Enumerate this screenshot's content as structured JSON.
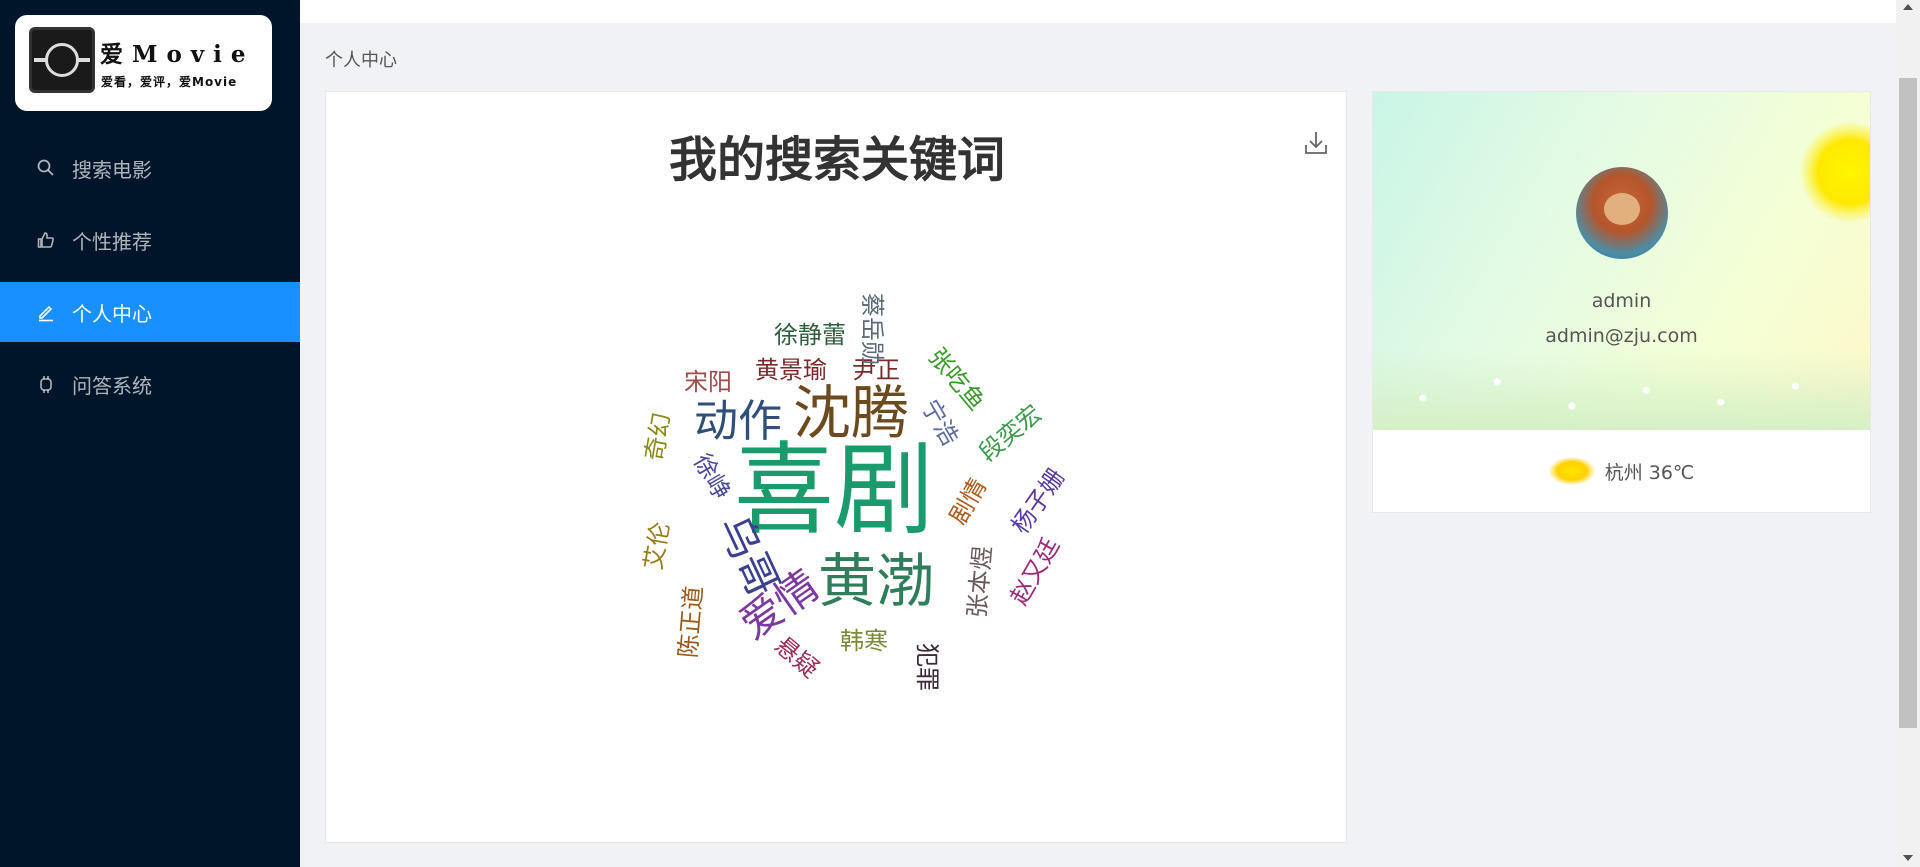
{
  "sidebar": {
    "logo": {
      "title": "爱Movie",
      "subtitle": "爱看，爱评，爱Movie"
    },
    "items": [
      {
        "label": "搜索电影",
        "icon": "search-icon"
      },
      {
        "label": "个性推荐",
        "icon": "thumbs-up-icon"
      },
      {
        "label": "个人中心",
        "icon": "edit-icon",
        "active": true
      },
      {
        "label": "问答系统",
        "icon": "robot-icon"
      }
    ]
  },
  "breadcrumb": "个人中心",
  "wordcloud": {
    "title": "我的搜索关键词",
    "words": [
      {
        "text": "喜剧",
        "color": "#1a9b6c"
      },
      {
        "text": "沈腾",
        "color": "#6b4a1e"
      },
      {
        "text": "黄渤",
        "color": "#2e7d5b"
      },
      {
        "text": "动作",
        "color": "#2f4f7a"
      },
      {
        "text": "乌哥",
        "color": "#3a3f8f"
      },
      {
        "text": "爱情",
        "color": "#7a3aa0"
      },
      {
        "text": "徐静蕾",
        "color": "#2e5e3e"
      },
      {
        "text": "黄景瑜",
        "color": "#7a2a2a"
      },
      {
        "text": "尹正",
        "color": "#7a2a2a"
      },
      {
        "text": "宋阳",
        "color": "#a04a4a"
      },
      {
        "text": "蔡岳勋",
        "color": "#5a6a7a"
      },
      {
        "text": "张吃鱼",
        "color": "#3a9a2a"
      },
      {
        "text": "宁浩",
        "color": "#5a6aa0"
      },
      {
        "text": "段奕宏",
        "color": "#3a9a4a"
      },
      {
        "text": "奇幻",
        "color": "#8a8a1a"
      },
      {
        "text": "徐峥",
        "color": "#4a4a9a"
      },
      {
        "text": "剧情",
        "color": "#b05a1a"
      },
      {
        "text": "杨子姗",
        "color": "#5a3aa0"
      },
      {
        "text": "艾伦",
        "color": "#9a7a1a"
      },
      {
        "text": "张本煜",
        "color": "#6a5a5a"
      },
      {
        "text": "赵又廷",
        "color": "#9a2a7a"
      },
      {
        "text": "陈正道",
        "color": "#9a5a1a"
      },
      {
        "text": "悬疑",
        "color": "#9a2a5a"
      },
      {
        "text": "韩寒",
        "color": "#7a8a3a"
      },
      {
        "text": "犯罪",
        "color": "#3a2a3a"
      }
    ]
  },
  "profile": {
    "username": "admin",
    "email": "admin@zju.com",
    "weather": "杭州 36℃",
    "avatar_icon": "bear-avatar",
    "weather_icon": "sun-icon"
  }
}
